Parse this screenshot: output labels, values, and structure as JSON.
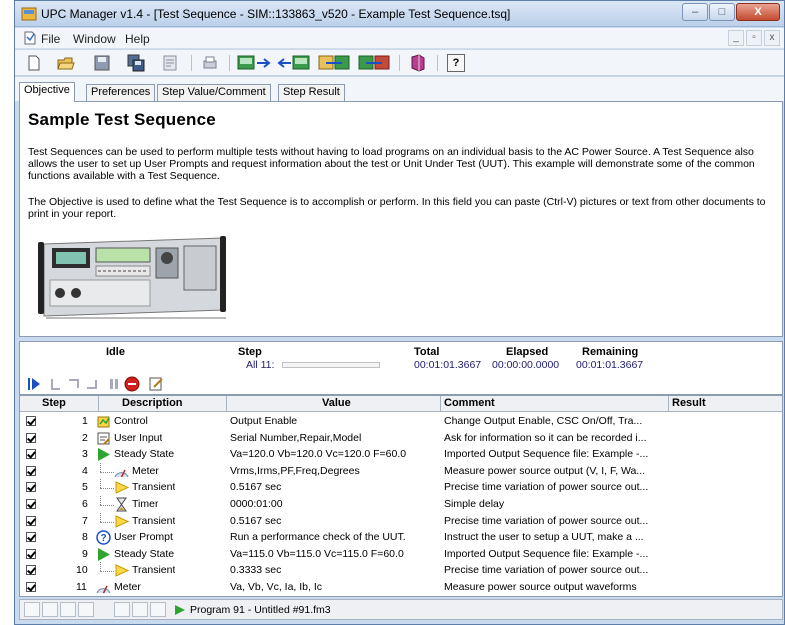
{
  "window": {
    "title": "UPC Manager v1.4 - [Test Sequence - SIM::133863_v520 - Example Test Sequence.tsq]",
    "min_label": "–",
    "max_label": "□",
    "close_label": "X"
  },
  "menu": {
    "items": [
      "File",
      "Window",
      "Help"
    ],
    "mdi_min": "_",
    "mdi_restore": "▫",
    "mdi_close": "x"
  },
  "toolbar": {
    "help_label": "?"
  },
  "tabs": [
    "Objective",
    "Preferences",
    "Step Value/Comment",
    "Step Result"
  ],
  "objective": {
    "title": "Sample Test Sequence",
    "para1": "Test Sequences can be used to perform multiple tests without having to load programs on an individual basis to the AC Power Source. A Test Sequence also allows the user to set up User Prompts and request information about the test or Unit Under Test (UUT). This example will demonstrate some of the common functions available with a Test Sequence.",
    "para2": "The Objective is used to define what the Test Sequence is to accomplish or perform. In this field you can paste (Ctrl-V) pictures or text from other documents to print in your report."
  },
  "status": {
    "state": "Idle",
    "step_label": "Step",
    "step_value": "All 11:",
    "step_progress": 0,
    "total_label": "Total",
    "total_value": "00:01:01.3667",
    "elapsed_label": "Elapsed",
    "elapsed_value": "00:00:00.0000",
    "remaining_label": "Remaining",
    "remaining_value": "00:01:01.3667"
  },
  "table": {
    "headers": {
      "step": "Step",
      "description": "Description",
      "value": "Value",
      "comment": "Comment",
      "result": "Result"
    },
    "rows": [
      {
        "num": "1",
        "icon": "control-icon",
        "description": "Control",
        "value": "Output Enable",
        "comment": "Change Output Enable, CSC On/Off, Tra..."
      },
      {
        "num": "2",
        "icon": "user-input-icon",
        "description": "User Input",
        "value": "Serial Number,Repair,Model",
        "comment": "Ask for information so it can be recorded i..."
      },
      {
        "num": "3",
        "icon": "play-icon",
        "description": "Steady State",
        "value": "Va=120.0 Vb=120.0 Vc=120.0 F=60.0",
        "comment": "Imported Output Sequence file: Example -..."
      },
      {
        "num": "4",
        "icon": "meter-icon",
        "description": "Meter",
        "value": "Vrms,Irms,PF,Freq,Degrees",
        "comment": "Measure power source output (V, I, F, Wa..."
      },
      {
        "num": "5",
        "icon": "transient-icon",
        "description": "Transient",
        "value": "0.5167 sec",
        "comment": "Precise time variation of power source out..."
      },
      {
        "num": "6",
        "icon": "hourglass-icon",
        "description": "Timer",
        "value": "0000:01:00",
        "comment": "Simple delay"
      },
      {
        "num": "7",
        "icon": "transient-icon",
        "description": "Transient",
        "value": "0.5167 sec",
        "comment": "Precise time variation of power source out..."
      },
      {
        "num": "8",
        "icon": "help-icon",
        "description": "User Prompt",
        "value": "Run a performance check of the UUT.",
        "comment": "Instruct the user to setup a UUT, make a ..."
      },
      {
        "num": "9",
        "icon": "play-icon",
        "description": "Steady State",
        "value": "Va=115.0 Vb=115.0 Vc=115.0 F=60.0",
        "comment": "Imported Output Sequence file: Example -..."
      },
      {
        "num": "10",
        "icon": "transient-icon",
        "description": "Transient",
        "value": "0.3333 sec",
        "comment": "Precise time variation of power source out..."
      },
      {
        "num": "11",
        "icon": "meter-icon",
        "description": "Meter",
        "value": "Va, Vb, Vc, Ia, Ib, Ic",
        "comment": "Measure power source output waveforms"
      }
    ]
  },
  "statusbar": {
    "program": "Program 91 - Untitled #91.fm3"
  },
  "colors": {
    "window_frame": "#c9d9ee",
    "accent": "#1a4fc7",
    "play_green": "#2fa52f",
    "stop_red": "#d21e1e"
  }
}
